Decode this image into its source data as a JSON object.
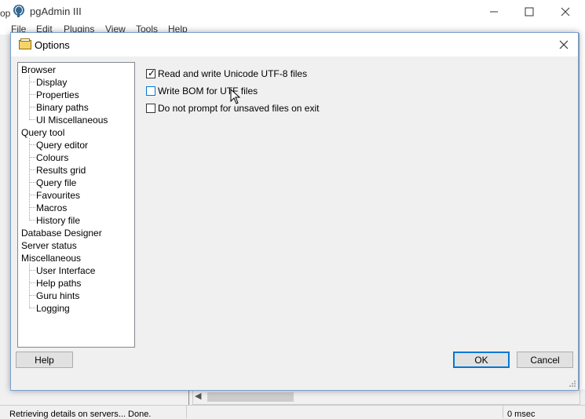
{
  "app": {
    "title": "pgAdmin III",
    "menu": [
      "File",
      "Edit",
      "Plugins",
      "View",
      "Tools",
      "Help"
    ],
    "left_sliver_text": "op",
    "status_left": "Retrieving details on servers... Done.",
    "status_right": "0 msec"
  },
  "dialog": {
    "title": "Options",
    "tree": [
      {
        "label": "Browser",
        "children": [
          "Display",
          "Properties",
          "Binary paths",
          "UI Miscellaneous"
        ]
      },
      {
        "label": "Query tool",
        "children": [
          "Query editor",
          "Colours",
          "Results grid",
          "Query file",
          "Favourites",
          "Macros",
          "History file"
        ]
      },
      {
        "label": "Database Designer",
        "children": []
      },
      {
        "label": "Server status",
        "children": []
      },
      {
        "label": "Miscellaneous",
        "children": [
          "User Interface",
          "Help paths",
          "Guru hints",
          "Logging"
        ]
      }
    ],
    "options": [
      {
        "label": "Read and write Unicode UTF-8 files",
        "checked": true
      },
      {
        "label": "Write BOM for UTF files",
        "checked": false
      },
      {
        "label": "Do not prompt for unsaved files on exit",
        "checked": false
      }
    ],
    "buttons": {
      "help": "Help",
      "ok": "OK",
      "cancel": "Cancel"
    }
  }
}
